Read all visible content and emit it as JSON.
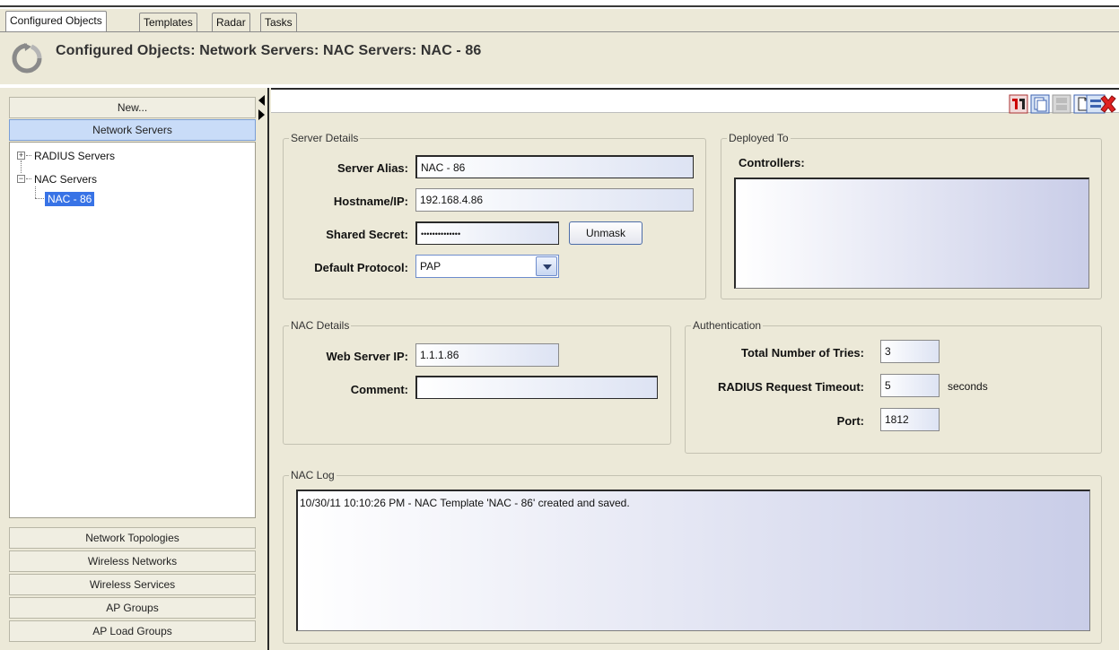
{
  "tabs": [
    "Configured Objects",
    "Templates",
    "Radar",
    "Tasks"
  ],
  "header": {
    "title": "Configured Objects: Network Servers: NAC Servers: NAC - 86"
  },
  "sidebar": {
    "new_label": "New...",
    "section_label": "Network Servers",
    "tree": {
      "radius": "RADIUS Servers",
      "nac": "NAC Servers",
      "nac_child": "NAC - 86"
    },
    "bottom_items": [
      "Network Topologies",
      "Wireless Networks",
      "Wireless Services",
      "AP Groups",
      "AP Load Groups"
    ]
  },
  "server_details": {
    "legend": "Server Details",
    "alias_label": "Server Alias:",
    "alias_value": "NAC - 86",
    "hostname_label": "Hostname/IP:",
    "hostname_value": "192.168.4.86",
    "secret_label": "Shared Secret:",
    "secret_value": "••••••••••••••",
    "unmask_label": "Unmask",
    "protocol_label": "Default Protocol:",
    "protocol_value": "PAP"
  },
  "deployed_to": {
    "legend": "Deployed To",
    "controllers_label": "Controllers:"
  },
  "nac_details": {
    "legend": "NAC Details",
    "web_ip_label": "Web Server IP:",
    "web_ip_value": "1.1.1.86",
    "comment_label": "Comment:",
    "comment_value": ""
  },
  "authentication": {
    "legend": "Authentication",
    "tries_label": "Total Number of Tries:",
    "tries_value": "3",
    "timeout_label": "RADIUS Request Timeout:",
    "timeout_value": "5",
    "timeout_unit": "seconds",
    "port_label": "Port:",
    "port_value": "1812"
  },
  "nac_log": {
    "legend": "NAC Log",
    "entry": "10/30/11 10:10:26 PM - NAC Template 'NAC - 86' created and saved."
  },
  "toolbar_icons": [
    "export-icon",
    "copy-icon",
    "save-icon",
    "new-document-icon",
    "minimize-icon",
    "delete-icon"
  ],
  "colors": {
    "panel_bg": "#ece9d8",
    "selection": "#3873e6",
    "delete": "#e02020"
  }
}
